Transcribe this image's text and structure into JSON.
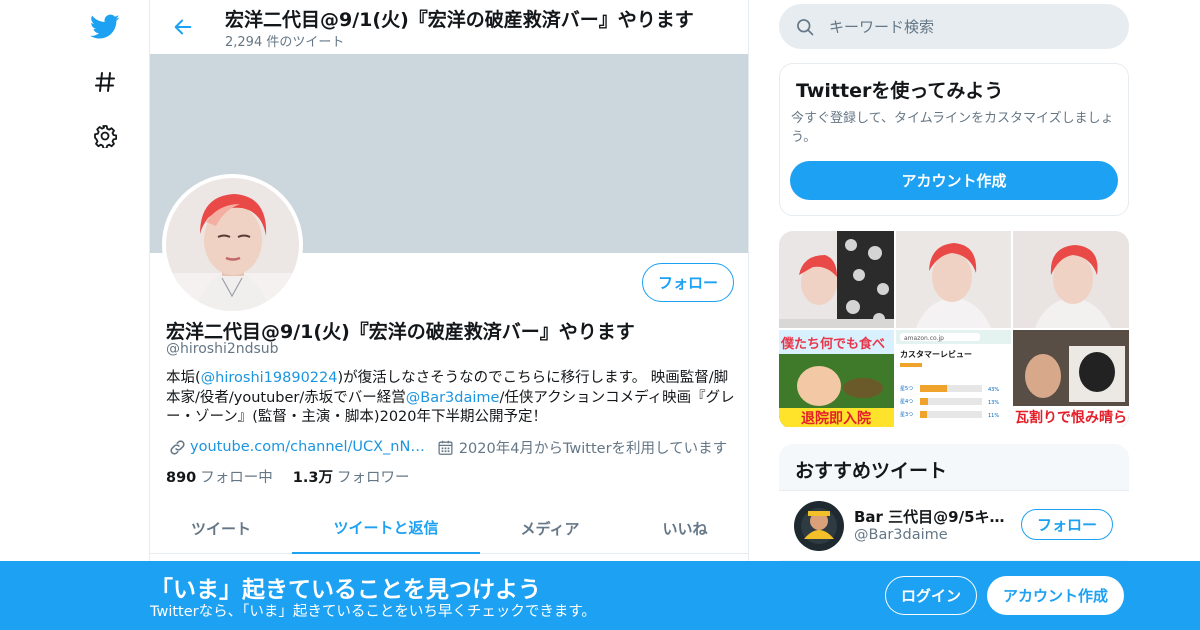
{
  "colors": {
    "accent": "#1da1f2",
    "link": "#1b95e0",
    "banner": "#ccd6dd",
    "muted": "#657786"
  },
  "nav": {
    "icons": [
      "twitter-logo-icon",
      "hashtag-icon",
      "gear-icon"
    ]
  },
  "header": {
    "title": "宏洋二代目@9/1(火)『宏洋の破産救済バー』やります",
    "tweet_count": "2,294 件のツイート"
  },
  "profile": {
    "follow_label": "フォロー",
    "name": "宏洋二代目@9/1(火)『宏洋の破産救済バー』やります",
    "handle": "@hiroshi2ndsub",
    "bio": {
      "p1": "本垢(",
      "mention1": "@hiroshi19890224",
      "p2": ")が復活しなさそうなのでこちらに移行します。 映画監督/脚本家/役者/youtuber/赤坂でバー経営",
      "mention2": "@Bar3daime",
      "p3": "/任侠アクションコメディ映画『グレー・ゾーン』(監督・主演・脚本)2020年下半期公開予定！"
    },
    "link": "youtube.com/channel/UCX_nN…",
    "joined": "2020年4月からTwitterを利用しています",
    "following_count": "890",
    "following_label": "フォロー中",
    "followers_count": "1.3万",
    "followers_label": "フォロワー"
  },
  "tabs": [
    "ツイート",
    "ツイートと返信",
    "メディア",
    "いいね"
  ],
  "active_tab": 1,
  "search": {
    "placeholder": "キーワード検索"
  },
  "signup_card": {
    "title": "Twitterを使ってみよう",
    "text": "今すぐ登録して、タイムラインをカスタマイズしましょう。",
    "button": "アカウント作成"
  },
  "media_thumbs": {
    "amazon_search": "amazon.co.jp",
    "review_title": "カスタマーレビュー",
    "rows": [
      "星5つ",
      "星4つ",
      "星3つ"
    ],
    "pcts": [
      "43%",
      "13%",
      "11%"
    ],
    "overlay_1": "僕たち何でも食べ",
    "overlay_2": "退院即入院",
    "overlay_3": "瓦割りで恨み晴ら"
  },
  "recommend": {
    "title": "おすすめツイート",
    "name": "Bar 三代目@9/5キム…",
    "handle": "@Bar3daime",
    "follow": "フォロー"
  },
  "bottom": {
    "title": "「いま」起きていることを見つけよう",
    "subtitle": "Twitterなら、「いま」起きていることをいち早くチェックできます。",
    "login": "ログイン",
    "signup": "アカウント作成"
  }
}
